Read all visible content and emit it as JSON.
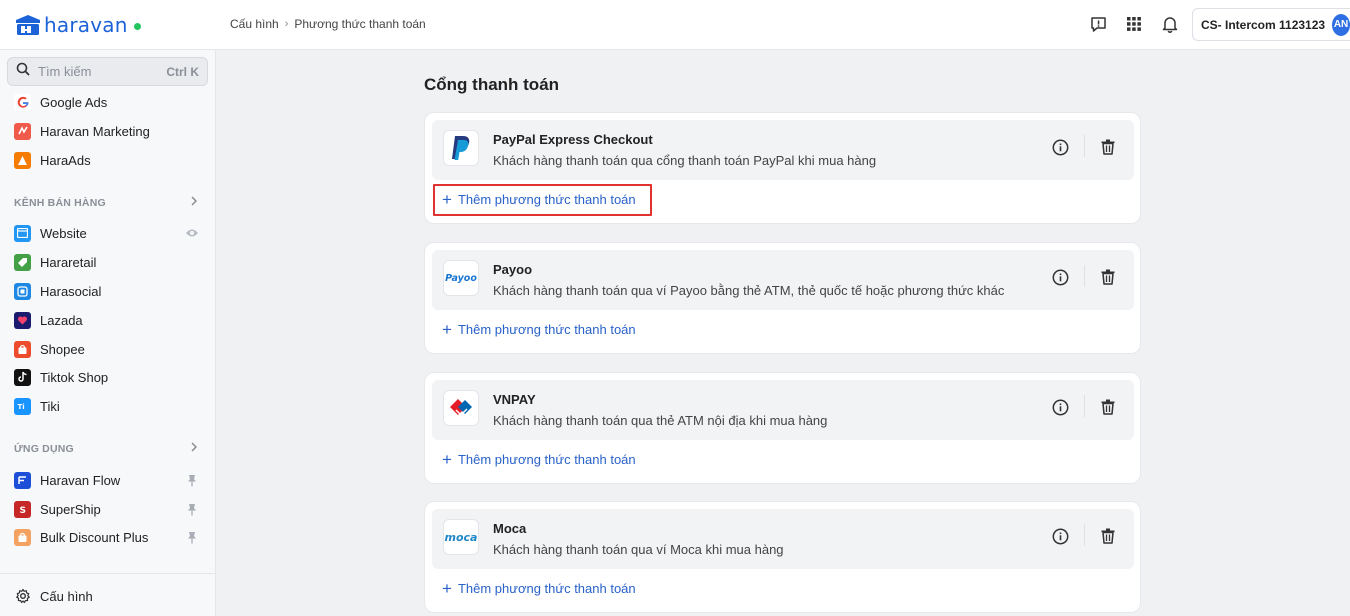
{
  "app": {
    "brand": "haravan"
  },
  "breadcrumb": {
    "parent": "Cấu hình",
    "separator": "›",
    "current": "Phương thức thanh toán"
  },
  "topbar": {
    "account_name": "CS- Intercom 1123123",
    "avatar_initials": "AN"
  },
  "sidebar": {
    "search_placeholder": "Tìm kiếm",
    "search_shortcut": "Ctrl K",
    "top_items": [
      {
        "label": "Google Ads",
        "icon": "google-ads-icon"
      },
      {
        "label": "Haravan Marketing",
        "icon": "haravan-marketing-icon"
      },
      {
        "label": "HaraAds",
        "icon": "haraads-icon"
      }
    ],
    "sales_section": {
      "label": "KÊNH BÁN HÀNG"
    },
    "sales_items": [
      {
        "label": "Website",
        "icon": "website-icon"
      },
      {
        "label": "Hararetail",
        "icon": "hararetail-icon"
      },
      {
        "label": "Harasocial",
        "icon": "harasocial-icon"
      },
      {
        "label": "Lazada",
        "icon": "lazada-icon"
      },
      {
        "label": "Shopee",
        "icon": "shopee-icon"
      },
      {
        "label": "Tiktok Shop",
        "icon": "tiktok-icon"
      },
      {
        "label": "Tiki",
        "icon": "tiki-icon"
      }
    ],
    "apps_section": {
      "label": "ỨNG DỤNG"
    },
    "app_items": [
      {
        "label": "Haravan Flow",
        "icon": "haravan-flow-icon"
      },
      {
        "label": "SuperShip",
        "icon": "supership-icon"
      },
      {
        "label": "Bulk Discount Plus",
        "icon": "bulk-discount-icon"
      }
    ],
    "settings": {
      "label": "Cấu hình"
    }
  },
  "main": {
    "title": "Cổng thanh toán",
    "add_label": "Thêm phương thức thanh toán",
    "gateways": [
      {
        "name": "PayPal Express Checkout",
        "description": "Khách hàng thanh toán qua cổng thanh toán PayPal khi mua hàng",
        "logo": "paypal-logo"
      },
      {
        "name": "Payoo",
        "description": "Khách hàng thanh toán qua ví Payoo bằng thẻ ATM, thẻ quốc tế hoặc phương thức khác",
        "logo": "payoo-logo",
        "logo_text": "Payoo"
      },
      {
        "name": "VNPAY",
        "description": "Khách hàng thanh toán qua thẻ ATM nội địa khi mua hàng",
        "logo": "vnpay-logo"
      },
      {
        "name": "Moca",
        "description": "Khách hàng thanh toán qua ví Moca khi mua hàng",
        "logo": "moca-logo",
        "logo_text": "moca"
      }
    ]
  },
  "colors": {
    "accent": "#2962c9",
    "highlight": "#e0332f",
    "brand": "#1d63d8"
  }
}
